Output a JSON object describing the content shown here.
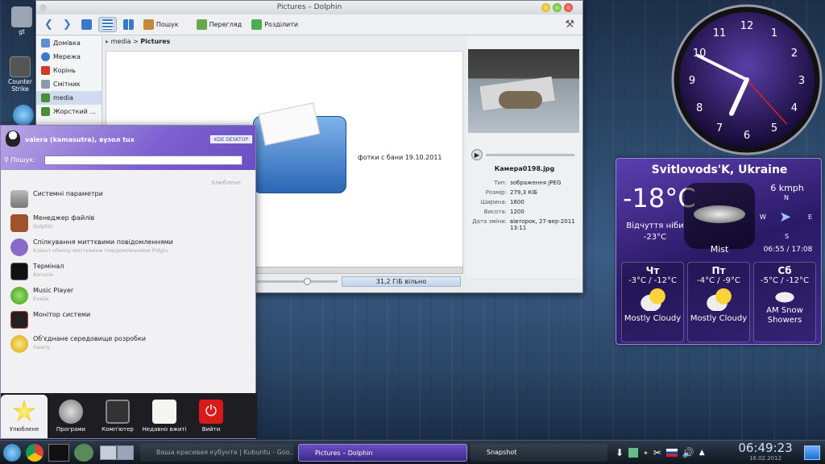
{
  "desktop": {
    "icons": [
      {
        "label": "gt"
      },
      {
        "label": "Counter Strike"
      }
    ]
  },
  "dolphin": {
    "title": "Pictures – Dolphin",
    "toolbar": {
      "search_label": "Пошук",
      "preview_label": "Перегляд",
      "split_label": "Розділити"
    },
    "places": [
      {
        "label": "Домівка"
      },
      {
        "label": "Мережа"
      },
      {
        "label": "Корінь"
      },
      {
        "label": "Смітник"
      },
      {
        "label": "media"
      },
      {
        "label": "Жорсткий ..."
      }
    ],
    "breadcrumb": {
      "part1": "media",
      "sep": ">",
      "part2": "Pictures"
    },
    "folder_label": "фотки с бани 19.10.2011",
    "status_free": "31,2 ГіБ вільно",
    "info": {
      "filename": "Камера0198.jpg",
      "rows": [
        {
          "key": "Тип:",
          "value": "зображення JPEG"
        },
        {
          "key": "Розмір:",
          "value": "279,3 КіБ"
        },
        {
          "key": "Ширина:",
          "value": "1600"
        },
        {
          "key": "Висота:",
          "value": "1200"
        },
        {
          "key": "Дата зміни:",
          "value": "вівторок, 27-вер-2011 13:11"
        }
      ]
    }
  },
  "kmenu": {
    "user": "valera (kamasutra), вузол tux",
    "kde_badge": "KDE DESKTOP",
    "search_label": "Пошук:",
    "section_label": "Улюблене",
    "items": [
      {
        "title": "Системні параметри",
        "subtitle": ""
      },
      {
        "title": "Менеджер файлів",
        "subtitle": "Dolphin"
      },
      {
        "title": "Спілкування миттєвими повідомленнями",
        "subtitle": "Клієнт обміну миттєвими повідомленнями Pidgin"
      },
      {
        "title": "Термінал",
        "subtitle": "Konsole"
      },
      {
        "title": "Music Player",
        "subtitle": "Exaile"
      },
      {
        "title": "Монітор системи",
        "subtitle": ""
      },
      {
        "title": "Об'єднане середовище розробки",
        "subtitle": "Geany"
      }
    ],
    "tabs": [
      {
        "label": "Улюблене"
      },
      {
        "label": "Програми"
      },
      {
        "label": "Комп'ютер"
      },
      {
        "label": "Недавно вжиті"
      },
      {
        "label": "Вийти"
      }
    ]
  },
  "clock": {
    "numbers": [
      "12",
      "1",
      "2",
      "3",
      "4",
      "5",
      "6",
      "7",
      "8",
      "9",
      "10",
      "11"
    ],
    "hour": 6,
    "minute": 49,
    "second": 23
  },
  "weather": {
    "location": "Svitlovods'K, Ukraine",
    "temp": "-18°C",
    "feels_label": "Відчуття ніби",
    "feels_value": "-23°C",
    "condition": "Mist",
    "wind": "6 kmph",
    "compass": {
      "n": "N",
      "w": "W",
      "e": "E",
      "s": "S"
    },
    "sun": "06:55 / 17:08",
    "forecast": [
      {
        "day": "Чт",
        "range": "-3°C / -12°C",
        "cond": "Mostly Cloudy"
      },
      {
        "day": "Пт",
        "range": "-4°C / -9°C",
        "cond": "Mostly Cloudy"
      },
      {
        "day": "Сб",
        "range": "-5°C / -12°C",
        "cond": "AM Snow Showers"
      }
    ]
  },
  "taskbar": {
    "tasks": [
      {
        "label": "Ваша красивая кубунта | Kubuntu - Goo..."
      },
      {
        "label": "Pictures – Dolphin"
      },
      {
        "label": "Snapshot"
      }
    ],
    "time": "06:49:23",
    "date": "16.02.2012"
  }
}
